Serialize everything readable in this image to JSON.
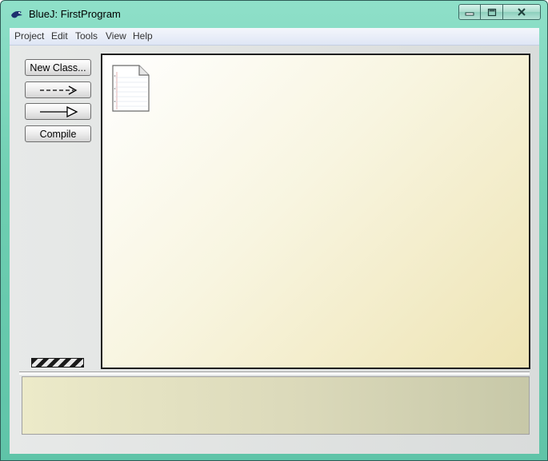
{
  "window": {
    "app_name": "BlueJ:",
    "project_name": "FirstProgram",
    "controls": {
      "minimize_icon": "minimize-icon",
      "maximize_icon": "maximize-icon",
      "close_icon": "close-icon"
    }
  },
  "menubar": {
    "items": [
      "Project",
      "Edit",
      "Tools",
      "View",
      "Help"
    ]
  },
  "toolbar": {
    "new_class_label": "New Class...",
    "uses_arrow_icon": "dashed-arrow-icon",
    "inheritance_arrow_icon": "inheritance-arrow-icon",
    "compile_label": "Compile"
  },
  "canvas": {
    "readme_icon": "readme-document-icon"
  },
  "colors": {
    "window_frame": "#6fcfb2",
    "canvas_bg": "#f8f5e0",
    "message_panel": "#dbd9ba"
  }
}
